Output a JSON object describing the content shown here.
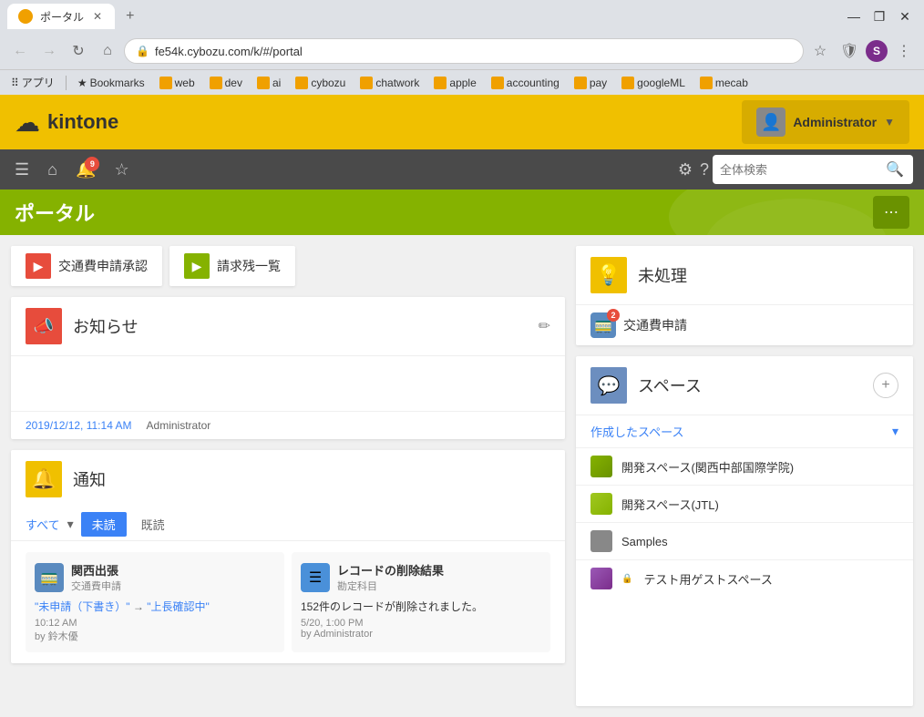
{
  "browser": {
    "tab_title": "ポータル",
    "tab_favicon": "🟡",
    "address": "fe54k.cybozu.com/k/#/portal",
    "new_tab_label": "+",
    "win_minimize": "—",
    "win_maximize": "❐",
    "win_close": "✕",
    "nav_back": "←",
    "nav_forward": "→",
    "nav_refresh": "↻",
    "nav_home": "⌂",
    "profile_letter": "S",
    "bookmarks": [
      {
        "label": "アプリ",
        "type": "apps"
      },
      {
        "label": "Bookmarks",
        "type": "star"
      },
      {
        "label": "web",
        "type": "folder_yellow"
      },
      {
        "label": "dev",
        "type": "folder_yellow"
      },
      {
        "label": "ai",
        "type": "folder_yellow"
      },
      {
        "label": "cybozu",
        "type": "folder_yellow"
      },
      {
        "label": "chatwork",
        "type": "folder_yellow"
      },
      {
        "label": "apple",
        "type": "folder_yellow"
      },
      {
        "label": "accounting",
        "type": "folder_yellow"
      },
      {
        "label": "pay",
        "type": "folder_yellow"
      },
      {
        "label": "googleML",
        "type": "folder_yellow"
      },
      {
        "label": "mecab",
        "type": "folder_yellow"
      }
    ]
  },
  "kintone": {
    "logo_text": "kintone",
    "user_name": "Administrator",
    "bell_count": "9",
    "search_placeholder": "全体検索",
    "portal_title": "ポータル",
    "more_btn": "⋯",
    "quick_links": [
      {
        "label": "交通費申請承認",
        "icon": "▶",
        "color": "red"
      },
      {
        "label": "請求残一覧",
        "icon": "▶",
        "color": "green"
      }
    ],
    "notice": {
      "title": "お知らせ",
      "date": "2019/12/12, 11:14 AM",
      "author": "Administrator"
    },
    "notification": {
      "title": "通知",
      "tab_all": "すべて",
      "tab_unread": "未読",
      "tab_read": "既読",
      "items": [
        {
          "title": "関西出張",
          "subtitle": "交通費申請",
          "body_link": "\"未申請（下書き）\"",
          "body_arrow": "→",
          "body_link2": "\"上長確認中\"",
          "time": "10:12 AM",
          "by": "by 鈴木優"
        },
        {
          "title": "レコードの削除結果",
          "subtitle": "勘定科目",
          "body": "152件のレコードが削除されました。",
          "time": "5/20, 1:00 PM",
          "by": "by Administrator"
        }
      ]
    },
    "unprocessed": {
      "title": "未処理",
      "items": [
        {
          "label": "交通費申請",
          "badge": "2"
        }
      ]
    },
    "spaces": {
      "title": "スペース",
      "section_label": "作成したスペース",
      "items": [
        {
          "name": "開発スペース(関西中部国際学院)",
          "color": "green1"
        },
        {
          "name": "開発スペース(JTL)",
          "color": "green2"
        },
        {
          "name": "Samples",
          "color": "photo"
        },
        {
          "name": "テスト用ゲストスペース",
          "color": "purple",
          "locked": true
        }
      ]
    }
  }
}
